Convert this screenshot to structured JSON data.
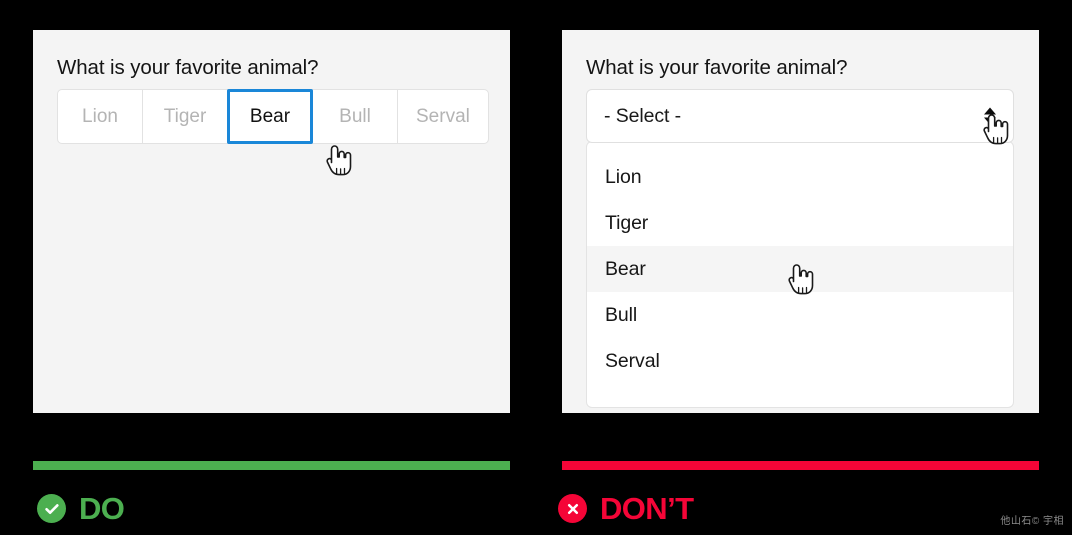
{
  "left_panel": {
    "question": "What is your favorite animal?",
    "options": [
      {
        "label": "Lion",
        "state": "unselected"
      },
      {
        "label": "Tiger",
        "state": "unselected"
      },
      {
        "label": "Bear",
        "state": "selected"
      },
      {
        "label": "Bull",
        "state": "unselected"
      },
      {
        "label": "Serval",
        "state": "unselected"
      }
    ]
  },
  "right_panel": {
    "question": "What is your favorite animal?",
    "select": {
      "value": "- Select -",
      "arrows_icon": "updown-triangles-icon"
    },
    "dropdown_options": [
      {
        "label": "Lion",
        "state": "normal"
      },
      {
        "label": "Tiger",
        "state": "normal"
      },
      {
        "label": "Bear",
        "state": "hovered"
      },
      {
        "label": "Bull",
        "state": "normal"
      },
      {
        "label": "Serval",
        "state": "normal"
      }
    ]
  },
  "footer": {
    "do": {
      "label": "DO",
      "icon": "check-circle-icon",
      "color": "#4caf50"
    },
    "dont": {
      "label": "DON’T",
      "icon": "x-circle-icon",
      "color": "#f50537"
    }
  },
  "watermark": "他山石©  宇相"
}
